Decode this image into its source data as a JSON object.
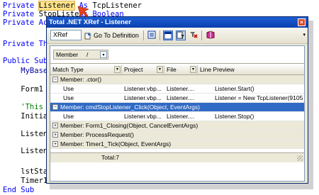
{
  "code": [
    {
      "kw1": "Private ",
      "hl": "Listener",
      "kw2": " As ",
      "rest": "TcpListener"
    },
    {
      "kw1": "Private ",
      "plain": "StopListe",
      "rest2": "As Boolean"
    },
    {
      "kw1": "Private Ac"
    },
    {
      "kw1": "Private Th"
    },
    {
      "kw1": "Public Sub"
    },
    {
      "plain": "    MyBase"
    },
    {
      "plain": "    Form1"
    },
    {
      "cm": "    'This"
    },
    {
      "plain": "    Initia"
    },
    {
      "plain": "    Listen"
    },
    {
      "plain": "    Listen"
    },
    {
      "plain": "    lstSta"
    },
    {
      "plain": "    Timer1.Enabled = ",
      "kw2": "True"
    },
    {
      "kw1": "End Sub"
    }
  ],
  "window": {
    "title": "Total .NET XRef - Listener",
    "close_glyph": "×"
  },
  "toolbar": {
    "xref_box": "XRef",
    "goto_label": "Go To Definition",
    "icons": [
      "list-icon",
      "window-icon",
      "filter-icon",
      "clear-icon",
      "book-icon"
    ]
  },
  "groupby": {
    "label": "Member",
    "slash": "/",
    "arrow": "▾"
  },
  "columns": [
    "Match Type",
    "Project",
    "File",
    "Line Preview"
  ],
  "rows": [
    {
      "type": "group",
      "expander": "−",
      "label": "Member: .ctor()",
      "selected": false
    },
    {
      "type": "item",
      "match": "Use",
      "project": "Listener.vbp...",
      "file": "Listener....",
      "preview": "Listener.Start()"
    },
    {
      "type": "item",
      "match": "Use",
      "project": "Listener.vbp...",
      "file": "Listener....",
      "preview": "Listener = New TcpListener(9105)"
    },
    {
      "type": "group",
      "expander": "−",
      "label": "Member: cmdStopListener_Click(Object, EventArgs)",
      "selected": true
    },
    {
      "type": "item",
      "match": "Use",
      "project": "Listener.vbp...",
      "file": "Listener....",
      "preview": "Listener.Stop()"
    },
    {
      "type": "group",
      "expander": "+",
      "label": "Member: Form1_Closing(Object, CancelEventArgs)",
      "selected": false
    },
    {
      "type": "group",
      "expander": "+",
      "label": "Member: ProcessRequest()",
      "selected": false
    },
    {
      "type": "group",
      "expander": "+",
      "label": "Member: Timer1_Tick(Object, EventArgs)",
      "selected": false
    }
  ],
  "footer": {
    "total": "Total:7"
  },
  "colors": {
    "titlebar": "#0b3fad",
    "selection": "#316ac5",
    "keyword": "#0000ff",
    "comment": "#008000",
    "highlight": "#ffe48a",
    "pointer": "#e8401c"
  }
}
